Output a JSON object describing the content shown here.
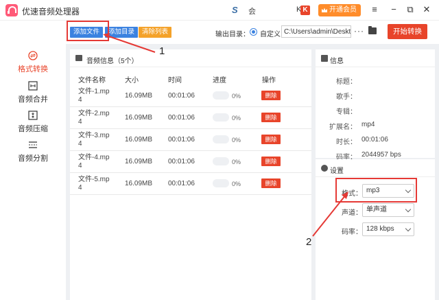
{
  "window": {
    "title": "优速音频处理器",
    "partner_text": "会",
    "vip_label": "开通会员",
    "k_prefix": "K",
    "k_logo": "K",
    "controls": [
      "≡",
      "−",
      "⧉",
      "✕"
    ]
  },
  "nav": {
    "items": [
      {
        "label": "格式转换",
        "icon": "convert-icon",
        "active": true
      },
      {
        "label": "音频合并",
        "icon": "merge-icon",
        "active": false
      },
      {
        "label": "音频压缩",
        "icon": "compress-icon",
        "active": false
      },
      {
        "label": "音频分割",
        "icon": "split-icon",
        "active": false
      }
    ]
  },
  "toolbar": {
    "add_file": "添加文件",
    "add_dir": "添加目录",
    "clear_list": "清除列表",
    "output_label": "输出目录：",
    "radio_label": "自定义",
    "path_value": "C:\\Users\\admin\\Deskto",
    "more": "···",
    "start": "开始转换"
  },
  "list": {
    "header": "音频信息（5个）",
    "columns": [
      "文件名称",
      "大小",
      "时间",
      "进度",
      "操作"
    ],
    "rows": [
      {
        "name": "文件-1.mp4",
        "size": "16.09MB",
        "time": "00:01:06",
        "progress": "0%",
        "action": "删除"
      },
      {
        "name": "文件-2.mp4",
        "size": "16.09MB",
        "time": "00:01:06",
        "progress": "0%",
        "action": "删除"
      },
      {
        "name": "文件-3.mp4",
        "size": "16.09MB",
        "time": "00:01:06",
        "progress": "0%",
        "action": "删除"
      },
      {
        "name": "文件-4.mp4",
        "size": "16.09MB",
        "time": "00:01:06",
        "progress": "0%",
        "action": "删除"
      },
      {
        "name": "文件-5.mp4",
        "size": "16.09MB",
        "time": "00:01:06",
        "progress": "0%",
        "action": "删除"
      }
    ]
  },
  "info": {
    "header": "信息",
    "fields": [
      {
        "label": "标题：",
        "value": ""
      },
      {
        "label": "歌手：",
        "value": ""
      },
      {
        "label": "专辑：",
        "value": ""
      },
      {
        "label": "扩展名：",
        "value": "mp4"
      },
      {
        "label": "时长：",
        "value": "00:01:06"
      },
      {
        "label": "码率：",
        "value": "2044957 bps"
      }
    ]
  },
  "settings": {
    "header": "设置",
    "format_label": "格式：",
    "format_value": "mp3",
    "channel_label": "声道：",
    "channel_value": "单声道",
    "bitrate_label": "码率：",
    "bitrate_value": "128 kbps"
  },
  "annotations": {
    "num1": "1",
    "num2": "2",
    "color": "#e53935"
  }
}
